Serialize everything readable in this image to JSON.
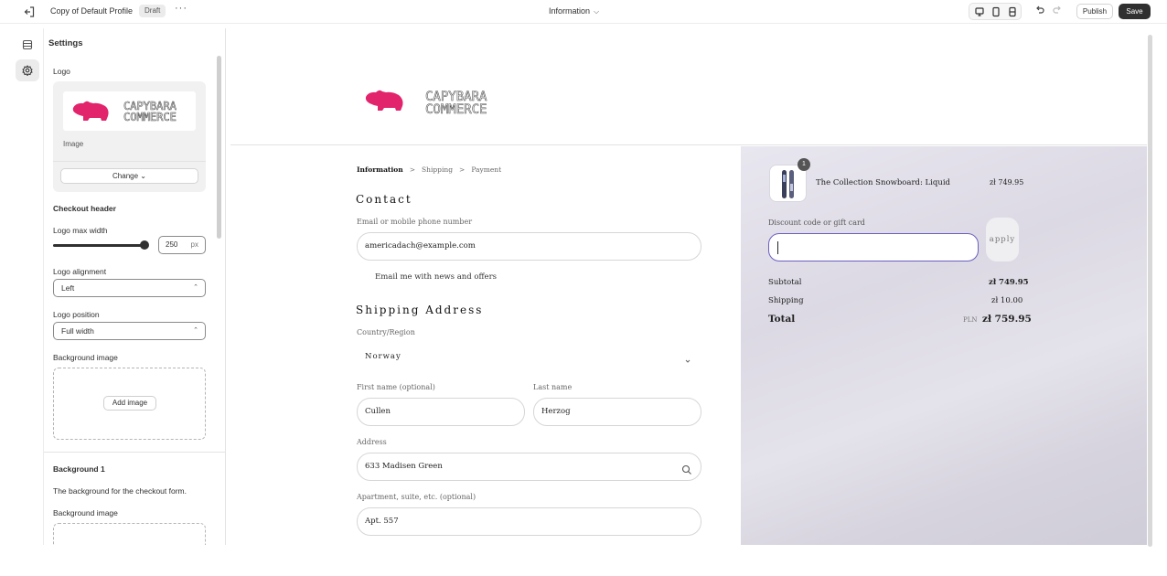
{
  "topbar": {
    "exit_icon": "exit-icon",
    "profile_name": "Copy of Default Profile",
    "badge": "Draft",
    "more": "···",
    "page_selector": "Information",
    "publish_label": "Publish",
    "save_label": "Save"
  },
  "rail": {
    "items": [
      "sections-icon",
      "settings-icon"
    ]
  },
  "settings": {
    "title": "Settings",
    "logo_label": "Logo",
    "image_label": "Image",
    "change_label": "Change",
    "checkout_header": "Checkout header",
    "logo_max_width_label": "Logo max width",
    "logo_max_width_value": "250",
    "logo_max_width_unit": "px",
    "logo_max_width_fraction": 0.9,
    "logo_alignment_label": "Logo alignment",
    "logo_alignment_value": "Left",
    "logo_position_label": "Logo position",
    "logo_position_value": "Full width",
    "background_image_label": "Background image",
    "add_image_label": "Add image",
    "background1_title": "Background 1",
    "background1_desc": "The background for the checkout form.",
    "background1_image_label": "Background image"
  },
  "brand": {
    "line1": "CAPYBARA",
    "line2": "COMMERCE",
    "color": "#e2246d"
  },
  "checkout": {
    "breadcrumbs": [
      "Information",
      "Shipping",
      "Payment"
    ],
    "contact_heading": "Contact",
    "email_label": "Email or mobile phone number",
    "email_value": "americadach@example.com",
    "news_label": "Email me with news and offers",
    "shipping_heading": "Shipping Address",
    "country_label": "Country/Region",
    "country_value": "Norway",
    "first_name_label": "First name (optional)",
    "first_name_value": "Cullen",
    "last_name_label": "Last name",
    "last_name_value": "Herzog",
    "address_label": "Address",
    "address_value": "633 Madisen Green",
    "apt_label": "Apartment, suite, etc. (optional)",
    "apt_value": "Apt. 557"
  },
  "summary": {
    "product_name": "The Collection Snowboard: Liquid",
    "product_price": "zł 749.95",
    "quantity": "1",
    "discount_label": "Discount code or gift card",
    "apply_label": "apply",
    "subtotal_label": "Subtotal",
    "subtotal_value": "zł 749.95",
    "shipping_label": "Shipping",
    "shipping_value": "zł 10.00",
    "total_label": "Total",
    "currency": "PLN",
    "total_value": "zł 759.95"
  }
}
